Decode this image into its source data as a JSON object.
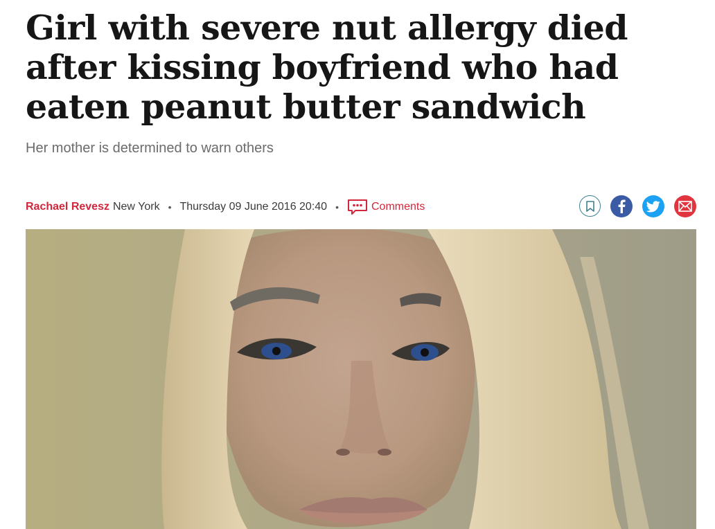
{
  "article": {
    "headline": "Girl with severe nut allergy died after kissing boyfriend who had eaten peanut butter sandwich",
    "standfirst": "Her mother is determined to warn others"
  },
  "meta": {
    "author": "Rachael Revesz",
    "location": "New York",
    "separator": "•",
    "date": "Thursday 09 June 2016 20:40",
    "comments_label": "Comments"
  },
  "share": {
    "icons": [
      "bookmark-icon",
      "facebook-icon",
      "twitter-icon",
      "email-icon"
    ]
  },
  "colors": {
    "accent_red": "#d1263b",
    "facebook": "#3b5ba5",
    "twitter": "#1da1f2",
    "email": "#e2343f",
    "bookmark_outline": "#3d7f8f"
  }
}
